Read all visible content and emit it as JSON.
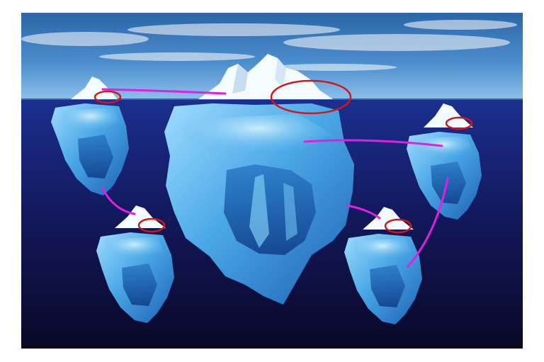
{
  "image": {
    "subject": "iceberg-fractal-collage",
    "colors": {
      "page_background": "#ffffff",
      "sky_top": "#2f6fb0",
      "sky_bottom": "#7fb5e6",
      "ocean_top": "#1a2e8c",
      "ocean_bottom": "#0a0a2e",
      "ice_light": "#cfefff",
      "ice_mid": "#58b6ea",
      "ice_dark": "#1a5fb0",
      "snow": "#ffffff",
      "connector_line": "#e020e0",
      "highlight_ellipse": "#d01818"
    },
    "elements": [
      "main-iceberg",
      "small-iceberg-top-left",
      "small-iceberg-right",
      "small-iceberg-bottom-left",
      "small-iceberg-bottom-center",
      "magenta-connector-lines",
      "red-highlight-ellipses"
    ]
  }
}
